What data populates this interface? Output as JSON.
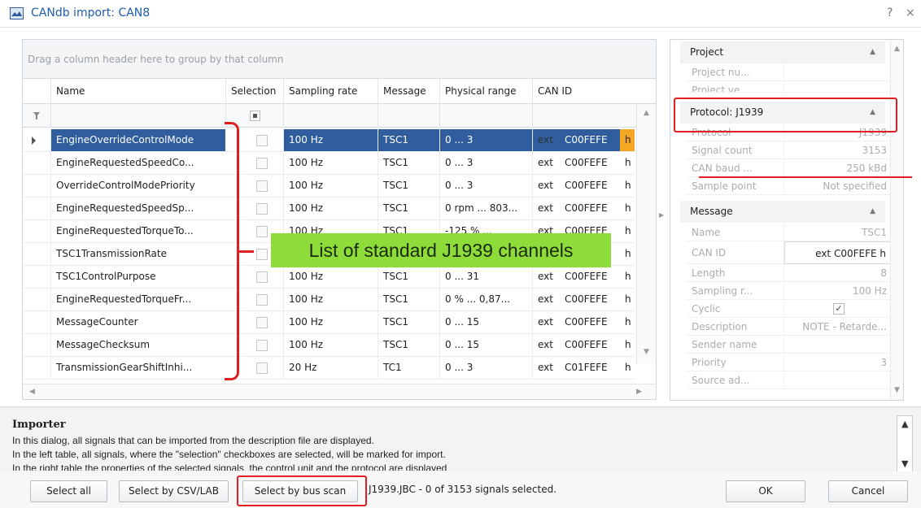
{
  "window": {
    "title": "CANdb import: CAN8",
    "help_label": "?",
    "close_label": "×"
  },
  "grid": {
    "group_hint": "Drag a column header here to group by that column",
    "columns": [
      "Name",
      "Selection",
      "Sampling rate",
      "Message",
      "Physical range",
      "CAN ID"
    ],
    "rows": [
      {
        "name": "EngineOverrideControlMode",
        "rate": "100 Hz",
        "message": "TSC1",
        "range": "0 ... 3",
        "ext": "ext",
        "id": "C00FEFE",
        "h": "h",
        "selected": true
      },
      {
        "name": "EngineRequestedSpeedCo...",
        "rate": "100 Hz",
        "message": "TSC1",
        "range": "0 ... 3",
        "ext": "ext",
        "id": "C00FEFE",
        "h": "h"
      },
      {
        "name": "OverrideControlModePriority",
        "rate": "100 Hz",
        "message": "TSC1",
        "range": "0 ... 3",
        "ext": "ext",
        "id": "C00FEFE",
        "h": "h"
      },
      {
        "name": "EngineRequestedSpeedSp...",
        "rate": "100 Hz",
        "message": "TSC1",
        "range": "0 rpm ... 803...",
        "ext": "ext",
        "id": "C00FEFE",
        "h": "h"
      },
      {
        "name": "EngineRequestedTorqueTo...",
        "rate": "100 Hz",
        "message": "TSC1",
        "range": "-125 % ...",
        "ext": "ext",
        "id": "C00FEFE",
        "h": "h"
      },
      {
        "name": "TSC1TransmissionRate",
        "rate": "",
        "message": "",
        "range": "",
        "ext": "",
        "id": "",
        "h": "h"
      },
      {
        "name": "TSC1ControlPurpose",
        "rate": "100 Hz",
        "message": "TSC1",
        "range": "0 ... 31",
        "ext": "ext",
        "id": "C00FEFE",
        "h": "h"
      },
      {
        "name": "EngineRequestedTorqueFr...",
        "rate": "100 Hz",
        "message": "TSC1",
        "range": "0 % ... 0,87...",
        "ext": "ext",
        "id": "C00FEFE",
        "h": "h"
      },
      {
        "name": "MessageCounter",
        "rate": "100 Hz",
        "message": "TSC1",
        "range": "0 ... 15",
        "ext": "ext",
        "id": "C00FEFE",
        "h": "h"
      },
      {
        "name": "MessageChecksum",
        "rate": "100 Hz",
        "message": "TSC1",
        "range": "0 ... 15",
        "ext": "ext",
        "id": "C00FEFE",
        "h": "h"
      },
      {
        "name": "TransmissionGearShiftInhi...",
        "rate": "20 Hz",
        "message": "TC1",
        "range": "0 ... 3",
        "ext": "ext",
        "id": "C01FEFE",
        "h": "h"
      }
    ]
  },
  "annotation": {
    "callout": "List of standard J1939 channels"
  },
  "panel": {
    "project_header": "Project",
    "project_rows": [
      {
        "key": "Project nu...",
        "value": ""
      },
      {
        "key": "Project ve...",
        "value": ""
      }
    ],
    "protocol_header": "Protocol: J1939",
    "protocol_rows": [
      {
        "key": "Protocol",
        "value": "J1939"
      },
      {
        "key": "Signal count",
        "value": "3153"
      },
      {
        "key": "CAN baud ...",
        "value": "250 kBd"
      },
      {
        "key": "Sample point",
        "value": "Not specified"
      }
    ],
    "message_header": "Message",
    "message_rows": [
      {
        "key": "Name",
        "value": "TSC1"
      },
      {
        "key": "CAN ID",
        "value": "ext  C00FEFE  h"
      },
      {
        "key": "Length",
        "value": "8"
      },
      {
        "key": "Sampling r...",
        "value": "100 Hz"
      },
      {
        "key": "Cyclic",
        "value": ""
      },
      {
        "key": "Description",
        "value": "NOTE - Retarde..."
      },
      {
        "key": "Sender name",
        "value": ""
      },
      {
        "key": "Priority",
        "value": "3"
      },
      {
        "key": "Source ad...",
        "value": ""
      }
    ]
  },
  "importer": {
    "title": "Importer",
    "lines": [
      "In this dialog, all signals that can be imported from the description file are displayed.",
      "In the left table, all signals, where the \"selection\" checkboxes are selected, will be marked for import.",
      "In the right table the properties of the selected signals, the control unit and the protocol are displayed"
    ]
  },
  "footer": {
    "select_all": "Select all",
    "select_by_csv": "Select by CSV/LAB",
    "select_by_bus_scan": "Select by bus scan",
    "status": "J1939.JBC  -  0 of 3153 signals selected.",
    "ok": "OK",
    "cancel": "Cancel"
  },
  "colors": {
    "accent": "#2f5d9e",
    "annotation_red": "#e02020",
    "callout_green": "#8ddc3a"
  }
}
